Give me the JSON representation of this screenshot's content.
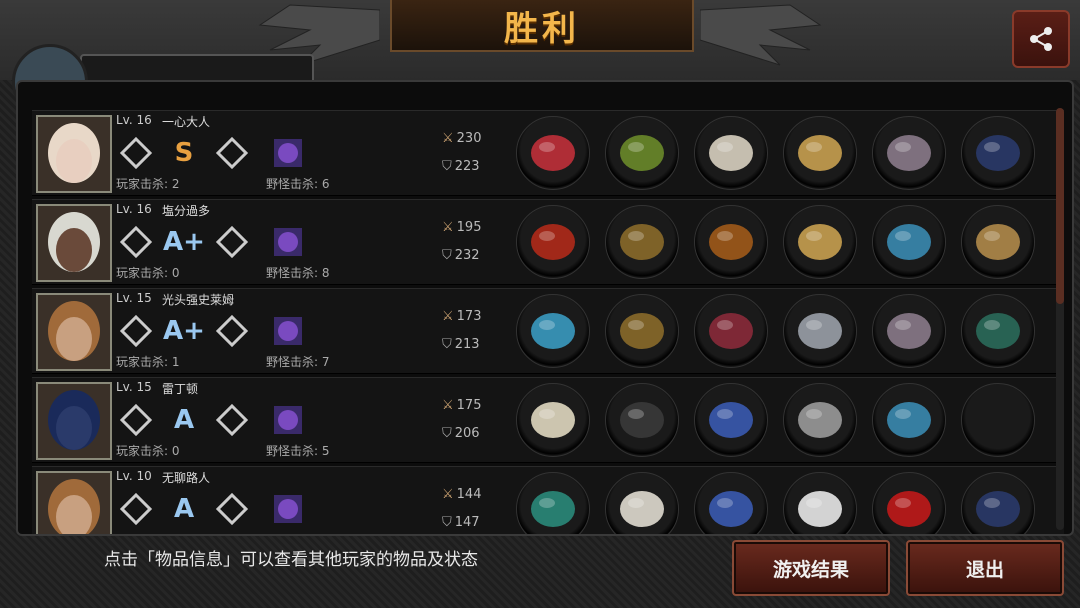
{
  "header": {
    "title": "胜利",
    "share_icon": "share-icon"
  },
  "rows": [
    {
      "level": "Lv. 16",
      "name": "一心大人",
      "skills": [
        "shuriken-icon",
        "S",
        "mask-icon",
        "monster-icon"
      ],
      "player_kills": "玩家击杀: 2",
      "monster_kills": "野怪击杀: 6",
      "attack": "230",
      "defense": "223",
      "items": [
        "spear-icon",
        "laurel-wreath-icon",
        "armor-icon",
        "bracelet-icon",
        "boots-icon",
        "flag-icon"
      ]
    },
    {
      "level": "Lv. 16",
      "name": "塩分過多",
      "skills": [
        "fist-icon",
        "A+",
        "diamond-icon",
        "monster-icon"
      ],
      "player_kills": "玩家击杀: 0",
      "monster_kills": "野怪击杀: 8",
      "attack": "195",
      "defense": "232",
      "items": [
        "glove-icon",
        "helmet-icon",
        "shield-icon",
        "bracelet-icon",
        "sneakers-icon",
        "chest-icon"
      ]
    },
    {
      "level": "Lv. 15",
      "name": "光头强史莱姆",
      "skills": [
        "rapier-icon",
        "A+",
        "triangle-icon",
        "monster-icon"
      ],
      "player_kills": "玩家击杀: 1",
      "monster_kills": "野怪击杀: 7",
      "attack": "173",
      "defense": "213",
      "items": [
        "blaster-icon",
        "helmet-icon",
        "vest-icon",
        "drill-icon",
        "boots-icon",
        "scope-icon"
      ]
    },
    {
      "level": "Lv. 15",
      "name": "雷丁顿",
      "skills": [
        "bat-icon",
        "A",
        "diamond-icon",
        "monster-icon"
      ],
      "player_kills": "玩家击杀: 0",
      "monster_kills": "野怪击杀: 5",
      "attack": "175",
      "defense": "206",
      "items": [
        "hammer-icon",
        "knight-helmet-icon",
        "armor-set-icon",
        "disc-icon",
        "sneakers-icon",
        "empty-slot"
      ]
    },
    {
      "level": "Lv. 10",
      "name": "无聊路人",
      "skills": [
        "rapier-icon",
        "A",
        "diamond-icon",
        "monster-icon"
      ],
      "player_kills": "",
      "monster_kills": "",
      "attack": "144",
      "defense": "147",
      "items": [
        "trident-icon",
        "mask-icon",
        "armor-set-icon",
        "bandage-icon",
        "heels-icon",
        "flag-icon"
      ]
    }
  ],
  "footer": {
    "hint": "点击「物品信息」可以查看其他玩家的物品及状态",
    "result_button": "游戏结果",
    "exit_button": "退出"
  },
  "colors": {
    "title": "#f3b64b",
    "button": "#6a2a1e",
    "scroll_thumb": "#5a2e22"
  }
}
